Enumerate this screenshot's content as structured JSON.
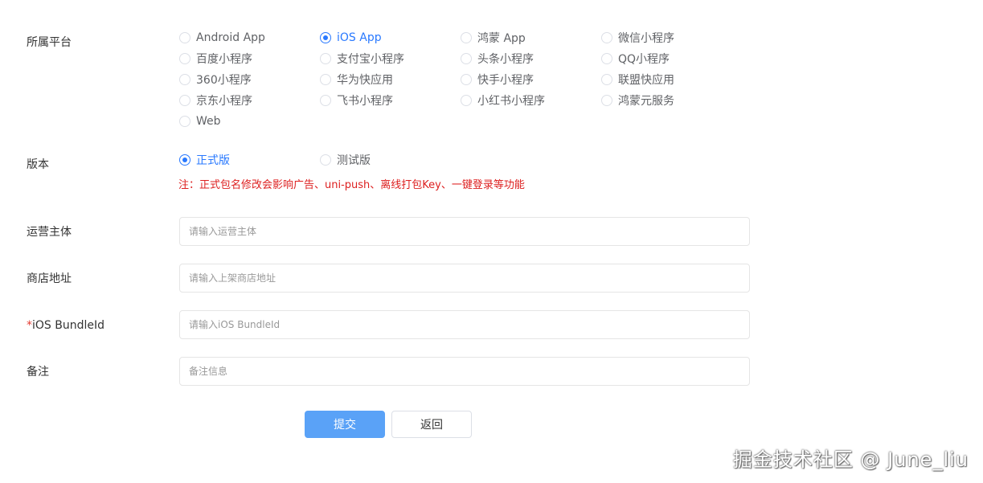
{
  "form": {
    "platform": {
      "label": "所属平台",
      "options": [
        {
          "label": "Android App",
          "checked": false
        },
        {
          "label": "iOS App",
          "checked": true
        },
        {
          "label": "鸿蒙 App",
          "checked": false
        },
        {
          "label": "微信小程序",
          "checked": false
        },
        {
          "label": "百度小程序",
          "checked": false
        },
        {
          "label": "支付宝小程序",
          "checked": false
        },
        {
          "label": "头条小程序",
          "checked": false
        },
        {
          "label": "QQ小程序",
          "checked": false
        },
        {
          "label": "360小程序",
          "checked": false
        },
        {
          "label": "华为快应用",
          "checked": false
        },
        {
          "label": "快手小程序",
          "checked": false
        },
        {
          "label": "联盟快应用",
          "checked": false
        },
        {
          "label": "京东小程序",
          "checked": false
        },
        {
          "label": "飞书小程序",
          "checked": false
        },
        {
          "label": "小红书小程序",
          "checked": false
        },
        {
          "label": "鸿蒙元服务",
          "checked": false
        },
        {
          "label": "Web",
          "checked": false
        }
      ]
    },
    "version": {
      "label": "版本",
      "options": [
        {
          "label": "正式版",
          "checked": true
        },
        {
          "label": "测试版",
          "checked": false
        }
      ],
      "note": "注：正式包名修改会影响广告、uni-push、离线打包Key、一键登录等功能"
    },
    "operator": {
      "label": "运营主体",
      "value": "",
      "placeholder": "请输入运营主体"
    },
    "store": {
      "label": "商店地址",
      "value": "",
      "placeholder": "请输入上架商店地址"
    },
    "bundle": {
      "required_mark": "*",
      "label": "iOS BundleId",
      "value": "",
      "placeholder": "请输入iOS BundleId"
    },
    "remark": {
      "label": "备注",
      "value": "",
      "placeholder": "备注信息"
    }
  },
  "buttons": {
    "submit": "提交",
    "back": "返回"
  },
  "watermark": "掘金技术社区 @ June_liu",
  "colors": {
    "accent": "#2979ff",
    "primary_button": "#5aa2f7",
    "note": "#dd1f1f",
    "required": "#e43d33"
  }
}
